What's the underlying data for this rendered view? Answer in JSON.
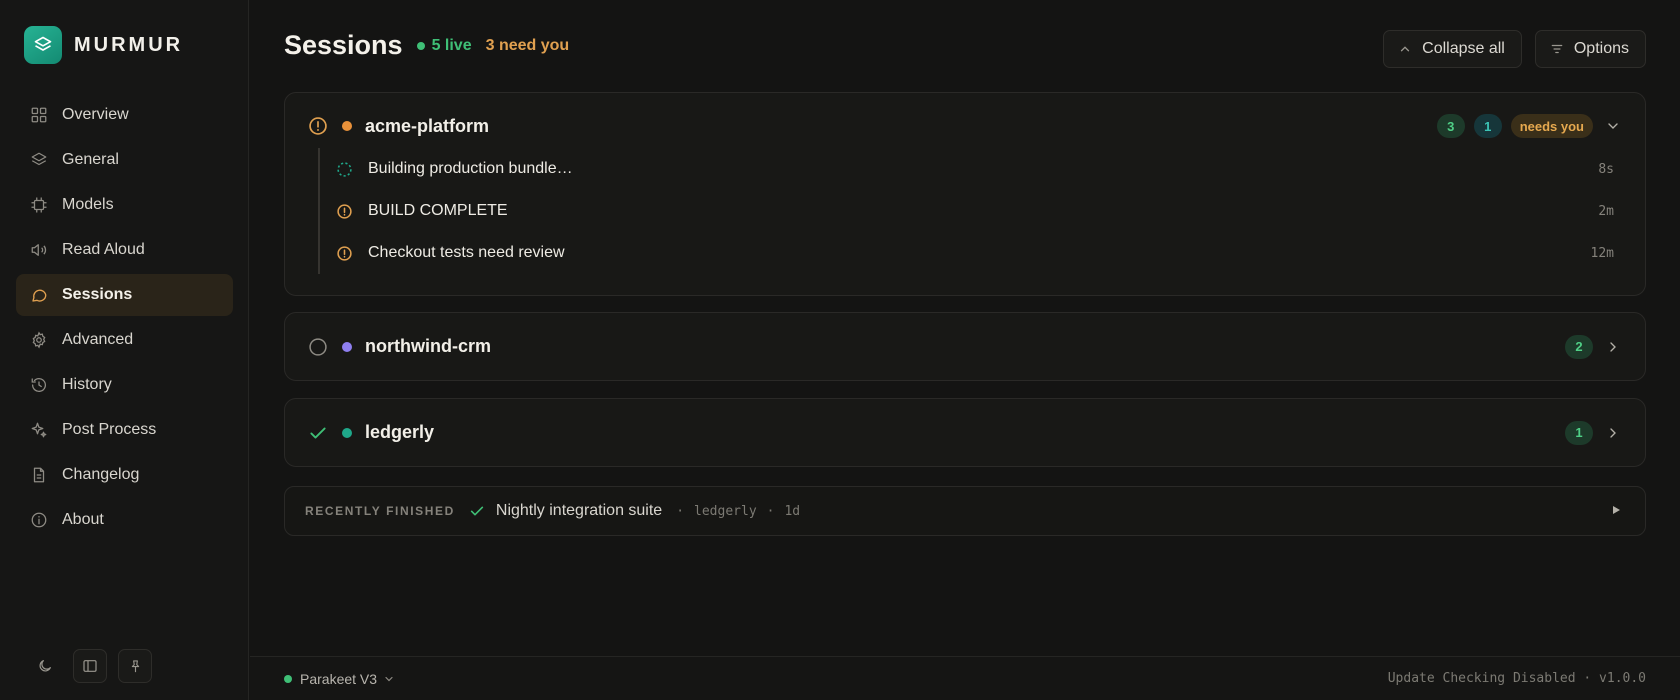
{
  "brand": {
    "name": "MURMUR",
    "accent": "#1fa88a"
  },
  "sidebar": {
    "items": [
      {
        "label": "Overview",
        "icon": "grid-icon"
      },
      {
        "label": "General",
        "icon": "layers-icon"
      },
      {
        "label": "Models",
        "icon": "chip-icon"
      },
      {
        "label": "Read Aloud",
        "icon": "speaker-icon"
      },
      {
        "label": "Sessions",
        "icon": "chat-bubble-icon",
        "active": true
      },
      {
        "label": "Advanced",
        "icon": "gear-icon"
      },
      {
        "label": "History",
        "icon": "history-icon"
      },
      {
        "label": "Post Process",
        "icon": "sparkle-icon"
      },
      {
        "label": "Changelog",
        "icon": "document-icon"
      },
      {
        "label": "About",
        "icon": "info-icon"
      }
    ],
    "bottom_controls": [
      "moon-icon",
      "sidebar-toggle-icon",
      "pin-icon"
    ]
  },
  "header": {
    "title": "Sessions",
    "live": "5 live",
    "need": "3 need you",
    "collapse_label": "Collapse all",
    "options_label": "Options"
  },
  "projects": [
    {
      "name": "acme-platform",
      "status": "attention",
      "dot_color": "#e8913a",
      "badges": [
        "3",
        "1"
      ],
      "needs_label": "needs you",
      "expanded": true,
      "tasks": [
        {
          "label": "Building production bundle…",
          "time": "8s",
          "state": "running"
        },
        {
          "label": "BUILD COMPLETE",
          "time": "2m",
          "state": "attention"
        },
        {
          "label": "Checkout tests need review",
          "time": "12m",
          "state": "attention"
        }
      ]
    },
    {
      "name": "northwind-crm",
      "status": "idle",
      "dot_color": "#8f7ff0",
      "badges": [
        "2"
      ],
      "expanded": false
    },
    {
      "name": "ledgerly",
      "status": "done",
      "dot_color": "#1fa88a",
      "badges": [
        "1"
      ],
      "expanded": false
    }
  ],
  "recently_finished": {
    "label": "RECENTLY FINISHED",
    "name": "Nightly integration suite",
    "project": "ledgerly",
    "age": "1d",
    "separator": "·"
  },
  "footer": {
    "model": "Parakeet V3",
    "status": "Update Checking Disabled · v1.0.0"
  },
  "colors": {
    "live": "#3fbf76",
    "attention": "#e0a050",
    "active_nav_bg": "#2a2419"
  }
}
